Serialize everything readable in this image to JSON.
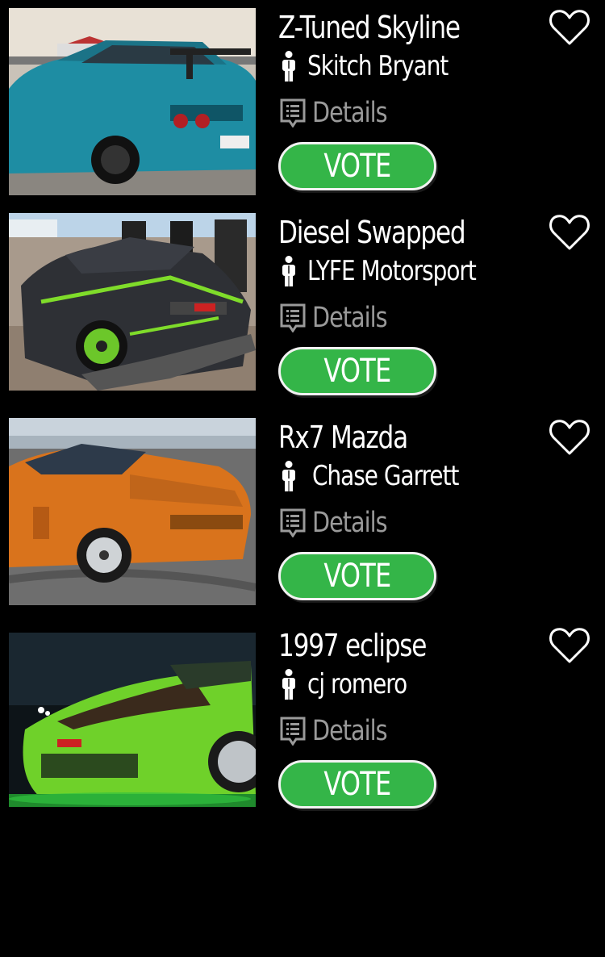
{
  "colors": {
    "background": "#000000",
    "vote_green": "#34b548",
    "details_gray": "#9a9a9a",
    "text": "#ffffff"
  },
  "entries": [
    {
      "title": "Z-Tuned Skyline",
      "owner": "Skitch Bryant",
      "details_label": "Details",
      "vote_label": "VOTE",
      "favorite_icon": "heart-outline-icon",
      "photo": "teal Nissan Skyline at car show"
    },
    {
      "title": "Diesel Swapped",
      "owner": "LYFE Motorsport",
      "details_label": "Details",
      "vote_label": "VOTE",
      "favorite_icon": "heart-outline-icon",
      "photo": "black and green Nissan GT-R"
    },
    {
      "title": "Rx7 Mazda",
      "owner": "Chase Garrett",
      "details_label": "Details",
      "vote_label": "VOTE",
      "favorite_icon": "heart-outline-icon",
      "photo": "orange Mazda RX-7 drifting"
    },
    {
      "title": "1997 eclipse",
      "owner": "cj romero",
      "details_label": "Details",
      "vote_label": "VOTE",
      "favorite_icon": "heart-outline-icon",
      "photo": "green Mitsubishi Eclipse at night"
    }
  ]
}
